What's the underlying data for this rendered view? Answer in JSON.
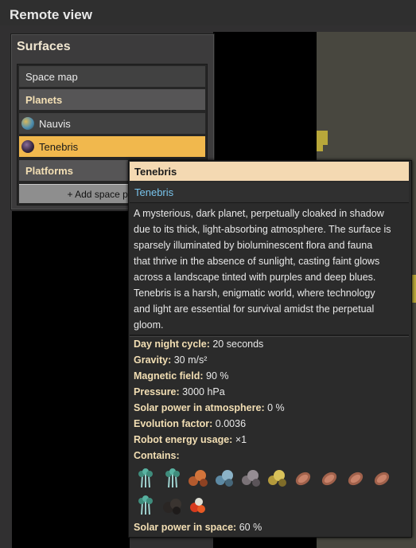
{
  "window": {
    "title": "Remote view"
  },
  "surfaces": {
    "title": "Surfaces",
    "items": [
      {
        "label": "Space map",
        "type": "item"
      },
      {
        "label": "Planets",
        "type": "header"
      },
      {
        "label": "Nauvis",
        "type": "planet",
        "icon": "nauvis-planet-icon"
      },
      {
        "label": "Tenebris",
        "type": "planet",
        "icon": "tenebris-planet-icon",
        "selected": true
      },
      {
        "label": "Platforms",
        "type": "header"
      }
    ],
    "add_button": "+ Add space platform"
  },
  "tooltip": {
    "title": "Tenebris",
    "subtitle": "Tenebris",
    "description_lines": [
      "A mysterious, dark planet, perpetually cloaked in shadow",
      "due to its thick, light-absorbing atmosphere. The surface is",
      "sparsely illuminated by bioluminescent flora and fauna",
      "that thrive in the absence of sunlight, casting faint glows",
      "across a landscape tinted with purples and deep blues.",
      "Tenebris is a harsh, enigmatic world, where technology",
      "and light are essential for survival amidst the perpetual",
      "gloom."
    ],
    "properties": [
      {
        "label": "Day night cycle:",
        "value": "20 seconds"
      },
      {
        "label": "Gravity:",
        "value": "30 m/s²"
      },
      {
        "label": "Magnetic field:",
        "value": "90 %"
      },
      {
        "label": "Pressure:",
        "value": "3000 hPa"
      },
      {
        "label": "Solar power in atmosphere:",
        "value": "0 %"
      },
      {
        "label": "Evolution factor:",
        "value": "0.0036"
      },
      {
        "label": "Robot energy usage:",
        "value": "×1"
      }
    ],
    "contains_label": "Contains:",
    "contains_icons": [
      "bioluminescent-tree-icon",
      "bioluminescent-tree-icon",
      "copper-ore-rock-icon",
      "iron-ore-rock-icon",
      "stone-rock-icon",
      "gold-ore-rock-icon",
      "fossil-egg-icon",
      "fossil-egg-icon",
      "fossil-egg-icon",
      "fossil-egg-icon",
      "bioluminescent-tree-icon",
      "dark-rock-icon",
      "glow-fruit-icon"
    ],
    "solar_space": {
      "label": "Solar power in space:",
      "value": "60 %"
    }
  },
  "colors": {
    "selected": "#f1b84d",
    "header_text": "#f3dfb4",
    "link_blue": "#79c4ec",
    "tooltip_head": "#f4d9b2"
  }
}
